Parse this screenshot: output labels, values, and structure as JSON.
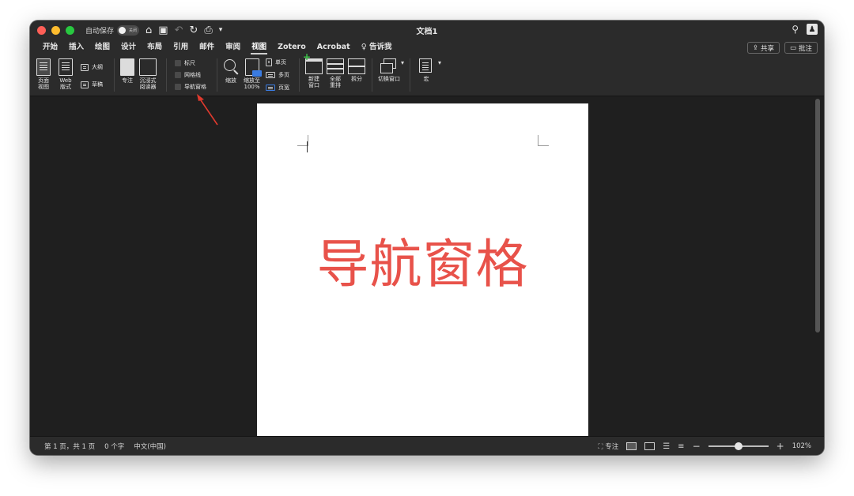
{
  "titlebar": {
    "autosave_label": "自动保存",
    "autosave_toggle": "关闭",
    "title": "文档1"
  },
  "menubar": {
    "tabs": [
      {
        "label": "开始"
      },
      {
        "label": "插入"
      },
      {
        "label": "绘图"
      },
      {
        "label": "设计"
      },
      {
        "label": "布局"
      },
      {
        "label": "引用"
      },
      {
        "label": "邮件"
      },
      {
        "label": "审阅"
      },
      {
        "label": "视图"
      },
      {
        "label": "Zotero"
      },
      {
        "label": "Acrobat"
      }
    ],
    "tell_me": "告诉我",
    "share": "共享",
    "comments": "批注"
  },
  "ribbon": {
    "page_view": "页面\n视图",
    "web_layout": "Web\n版式",
    "outline": "大纲",
    "draft": "草稿",
    "focus": "专注",
    "immersive_reader": "沉浸式\n阅读器",
    "ruler": "标尺",
    "gridlines": "网格线",
    "nav_pane": "导航窗格",
    "zoom": "缩放",
    "zoom_100": "缩放至\n100%",
    "one_page": "单页",
    "multiple_pages": "多页",
    "page_width": "页宽",
    "new_window": "新建\n窗口",
    "arrange_all": "全部\n重排",
    "split": "拆分",
    "switch_windows": "切换窗口",
    "macros": "宏"
  },
  "document": {
    "body_text": "导航窗格",
    "text_color": "#e8524a"
  },
  "statusbar": {
    "page": "第 1 页，共 1 页",
    "words": "0 个字",
    "language": "中文(中国)",
    "focus": "专注",
    "zoom": "102%",
    "zoom_level_percent": 102
  },
  "annotation": {
    "arrow_color": "#e03a2e"
  }
}
